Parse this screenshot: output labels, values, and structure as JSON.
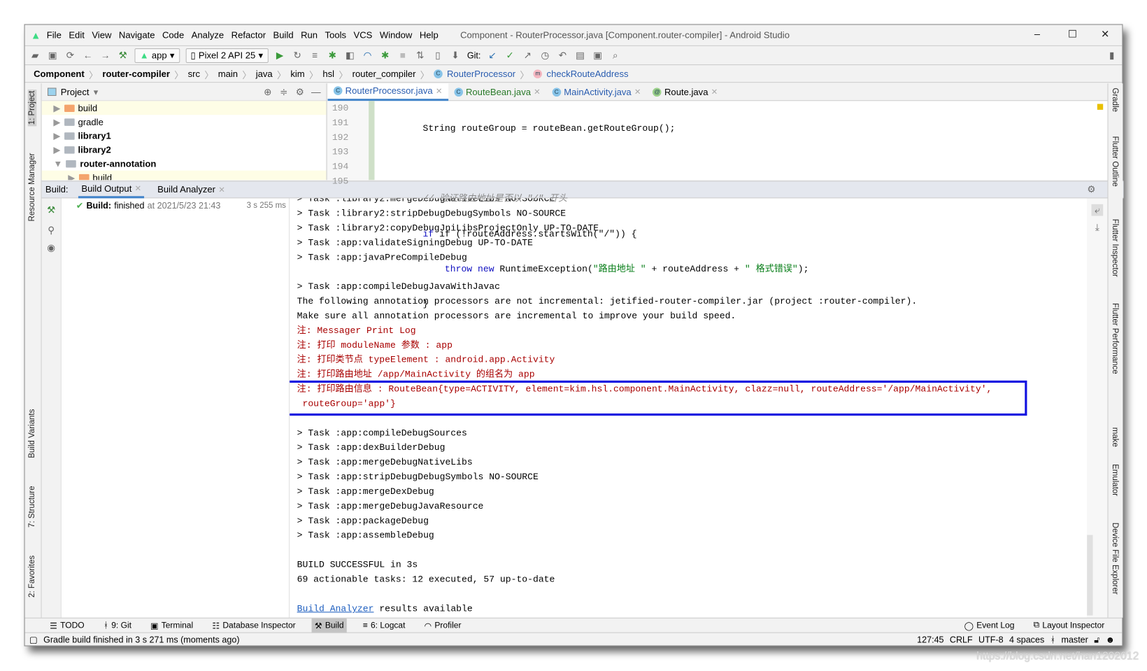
{
  "window": {
    "title": "Component - RouterProcessor.java [Component.router-compiler] - Android Studio",
    "minimize": "–",
    "maximize": "☐",
    "close": "✕"
  },
  "menu": [
    "File",
    "Edit",
    "View",
    "Navigate",
    "Code",
    "Analyze",
    "Refactor",
    "Build",
    "Run",
    "Tools",
    "VCS",
    "Window",
    "Help"
  ],
  "toolbar": {
    "run_config": "app",
    "device": "Pixel 2 API 25",
    "git_label": "Git:"
  },
  "breadcrumb": [
    "Component",
    "router-compiler",
    "src",
    "main",
    "java",
    "kim",
    "hsl",
    "router_compiler",
    "RouterProcessor",
    "checkRouteAddress"
  ],
  "left_strip": [
    "1: Project",
    "Resource Manager",
    "Build Variants",
    "7: Structure",
    "2: Favorites"
  ],
  "project": {
    "title": "Project",
    "items": [
      {
        "label": "build",
        "bold": false
      },
      {
        "label": "gradle",
        "bold": false
      },
      {
        "label": "library1",
        "bold": true
      },
      {
        "label": "library2",
        "bold": true
      },
      {
        "label": "router-annotation",
        "bold": true
      },
      {
        "label": "build",
        "bold": false
      }
    ]
  },
  "editor": {
    "tabs": [
      "RouterProcessor.java",
      "RouteBean.java",
      "MainActivity.java",
      "Route.java"
    ],
    "line_numbers": [
      "190",
      "191",
      "192",
      "193",
      "194",
      "195"
    ],
    "lines": {
      "l190": "String routeGroup = routeBean.getRouteGroup();",
      "l192": "// 验证路由地址是否以 \"/\" 开头",
      "l193": "if (!routeAddress.startsWith(\"/\")) {",
      "l194_kw1": "throw",
      "l194_kw2": "new",
      "l194_a": " RuntimeException(",
      "l194_s1": "\"路由地址 \"",
      "l194_b": " + routeAddress + ",
      "l194_s2": "\" 格式错误\"",
      "l194_c": ");",
      "l195": "}"
    }
  },
  "build": {
    "label": "Build:",
    "tabs": [
      "Build Output",
      "Build Analyzer"
    ],
    "tree_bold": "Build:",
    "tree_status": "finished",
    "tree_time": "at 2021/5/23 21:43",
    "tree_duration": "3 s 255 ms"
  },
  "console": {
    "lines_a": [
      "> Task :library2:mergeDebugNativeLibs NO-SOURCE",
      "> Task :library2:stripDebugDebugSymbols NO-SOURCE",
      "> Task :library2:copyDebugJniLibsProjectOnly UP-TO-DATE",
      "> Task :app:validateSigningDebug UP-TO-DATE",
      "> Task :app:javaPreCompileDebug",
      "",
      "> Task :app:compileDebugJavaWithJavac",
      "The following annotation processors are not incremental: jetified-router-compiler.jar (project :router-compiler).",
      "Make sure all annotation processors are incremental to improve your build speed."
    ],
    "notes": [
      "注: Messager Print Log",
      "注: 打印 moduleName 参数 : app",
      "注: 打印类节点 typeElement : android.app.Activity",
      "注: 打印路由地址 /app/MainActivity 的组名为 app"
    ],
    "highlight": [
      "注: 打印路由信息 : RouteBean{type=ACTIVITY, element=kim.hsl.component.MainActivity, clazz=null, routeAddress='/app/MainActivity',",
      " routeGroup='app'}"
    ],
    "lines_b": [
      "",
      "> Task :app:compileDebugSources",
      "> Task :app:dexBuilderDebug",
      "> Task :app:mergeDebugNativeLibs",
      "> Task :app:stripDebugDebugSymbols NO-SOURCE",
      "> Task :app:mergeDexDebug",
      "> Task :app:mergeDebugJavaResource",
      "> Task :app:packageDebug",
      "> Task :app:assembleDebug",
      "",
      "BUILD SUCCESSFUL in 3s",
      "69 actionable tasks: 12 executed, 57 up-to-date",
      ""
    ],
    "link": "Build Analyzer",
    "link_rest": " results available"
  },
  "right_strip": [
    "Gradle",
    "Flutter Outline",
    "Flutter Inspector",
    "Flutter Performance",
    "make",
    "Emulator",
    "Device File Explorer"
  ],
  "bottom_tools": [
    "TODO",
    "9: Git",
    "Terminal",
    "Database Inspector",
    "Build",
    "6: Logcat",
    "Profiler"
  ],
  "bottom_right": [
    "Event Log",
    "Layout Inspector"
  ],
  "status": {
    "message": "Gradle build finished in 3 s 271 ms (moments ago)",
    "position": "127:45",
    "line_sep": "CRLF",
    "encoding": "UTF-8",
    "indent": "4 spaces",
    "branch": "master"
  },
  "watermark": "https://blog.csdn.net/han1202012",
  "colors": {
    "accent": "#4083c9",
    "highlight_box": "#1010e0",
    "note_red": "#a80000",
    "android_green": "#3ddc84"
  }
}
